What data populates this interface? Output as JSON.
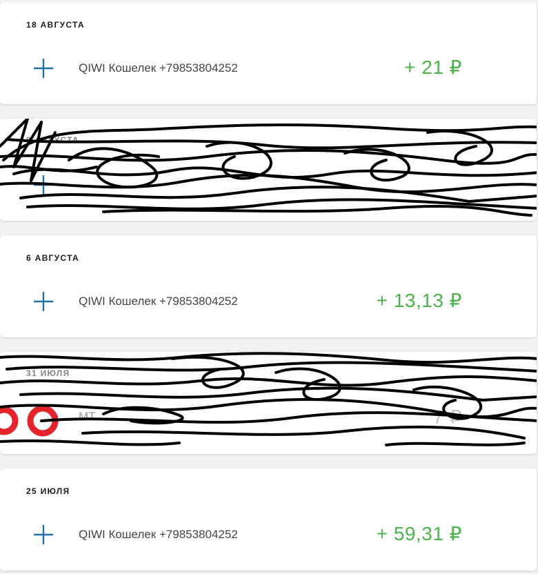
{
  "accent_color": "#1d6fa5",
  "amount_color": "#4bb34b",
  "transactions": [
    {
      "date": "18 АВГУСТА",
      "icon": "plus-icon",
      "description": "QIWI Кошелек +79853804252",
      "amount": "+ 21 ₽"
    },
    {
      "date": "8 АВГУСТА",
      "icon": "plus-icon",
      "description": "",
      "amount": "",
      "redacted": true
    },
    {
      "date": "6 АВГУСТА",
      "icon": "plus-icon",
      "description": "QIWI Кошелек +79853804252",
      "amount": "+ 13,13 ₽"
    },
    {
      "date": "31 ИЮЛЯ",
      "icon": "bank-logo-icon",
      "description": "МТ",
      "amount": "7 ₽",
      "redacted": true
    },
    {
      "date": "25 ИЮЛЯ",
      "icon": "plus-icon",
      "description": "QIWI Кошелек +79853804252",
      "amount": "+ 59,31 ₽"
    }
  ]
}
